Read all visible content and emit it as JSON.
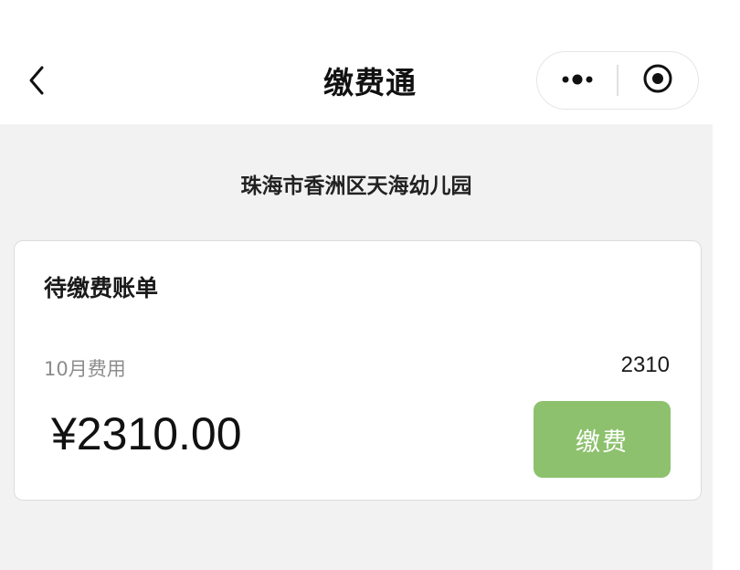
{
  "nav": {
    "title": "缴费通",
    "back_icon": "chevron-left-icon",
    "menu_icon": "more-dots-icon",
    "close_icon": "target-icon"
  },
  "school_name": "珠海市香洲区天海幼儿园",
  "bill_card": {
    "title": "待缴费账单",
    "item_label": "10月费用",
    "item_code": "2310",
    "amount": "¥2310.00",
    "pay_button_label": "缴费"
  },
  "colors": {
    "page_background": "#f2f2f2",
    "card_background": "#ffffff",
    "pay_button": "#8dc16d",
    "pay_button_text": "#ffffff",
    "muted_text": "#8c8c8c"
  }
}
